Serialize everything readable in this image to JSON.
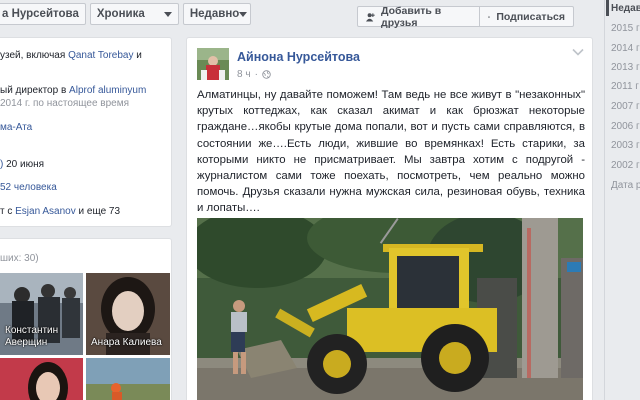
{
  "header": {
    "profile_name": "а Нурсейтова",
    "chronicle_label": "Хроника",
    "recent_label": "Недавно",
    "add_friend_label": "Добавить в друзья",
    "subscribe_label": "Подписаться"
  },
  "intro": {
    "line1": "узей, включая ",
    "line1_link": "Qanat Torebay",
    "line1_tail": " и",
    "line2": "ый директор в ",
    "line2_link": "Alprof aluminyum",
    "line3": "2014 г. по настоящее время",
    "line4_link": "ма-Ата",
    "line5_link": ")",
    "line5_tail": " 20 июня",
    "line6_link": "52 человека",
    "line7": "т с ",
    "line7_link": "Esjan Asanov",
    "line7_tail": " и еще 73"
  },
  "photos": {
    "header": "ших: 30)",
    "items": [
      {
        "caption": "Константин Аверщин"
      },
      {
        "caption": "Анара Калиева"
      },
      {
        "caption": ""
      },
      {
        "caption": ""
      }
    ]
  },
  "post": {
    "author": "Айнона Нурсейтова",
    "time": "8 ч",
    "text": "Алматинцы, ну давайте поможем! Там ведь не все живут в \"незаконных\" крутых коттеджах, как сказал акимат и как брюзжат некоторые граждане…якобы крутые дома попали, вот и пусть сами справляются, в состоянии же….Есть люди, жившие во времянках! Есть старики, за которыми никто не присматривает. Мы завтра хотим с подругой - журналистом сами тоже поехать, посмотреть, чем реально можно помочь. Друзья сказали нужна мужская сила, резиновая обувь, техника и лопаты…."
  },
  "years": {
    "current": "Недав",
    "list": [
      "2015 г",
      "2014 г",
      "2013 г",
      "2011 г",
      "2007 г",
      "2006 г",
      "2003 г",
      "2002 г",
      "Дата р"
    ]
  },
  "colors": {
    "link": "#365899",
    "background": "#e9ebee",
    "card_border": "#dddfe2",
    "muted": "#90949c"
  }
}
